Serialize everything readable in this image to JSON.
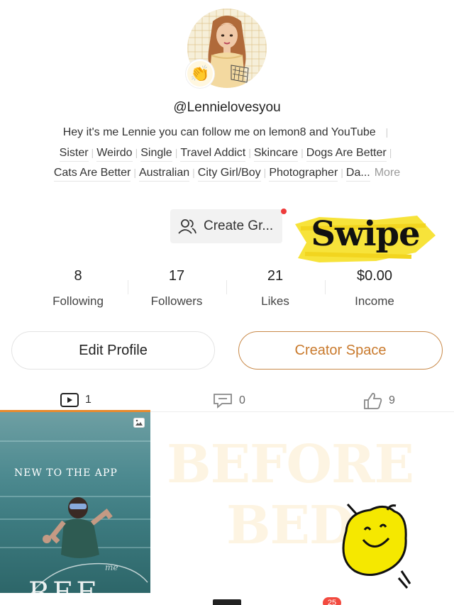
{
  "profile": {
    "username": "@Lennielovesyou",
    "avatar_icon": "cartoon-girl-avatar",
    "avatar_badge_icon": "clapping-hands-emoji",
    "bio": "Hey it's me Lennie you can follow me on lemon8 and YouTube",
    "tags_row1": [
      "Sister",
      "Weirdo",
      "Single",
      "Travel Addict",
      "Skincare",
      "Dogs Are Better"
    ],
    "tags_row2": [
      "Cats Are Better",
      "Australian",
      "City Girl/Boy",
      "Photographer",
      "Da..."
    ],
    "more_label": "More"
  },
  "create_group": {
    "label": "Create Gr...",
    "icon": "group-icon",
    "has_notification_dot": true
  },
  "sticker": {
    "text": "Swipe",
    "color": "#f7e33a"
  },
  "stats": [
    {
      "value": "8",
      "label": "Following"
    },
    {
      "value": "17",
      "label": "Followers"
    },
    {
      "value": "21",
      "label": "Likes"
    },
    {
      "value": "$0.00",
      "label": "Income"
    }
  ],
  "buttons": {
    "edit_profile": "Edit Profile",
    "creator_space": "Creator Space"
  },
  "tabs": [
    {
      "icon": "video-icon",
      "count": "1",
      "active": true
    },
    {
      "icon": "comment-icon",
      "count": "0",
      "active": false
    },
    {
      "icon": "thumbs-up-icon",
      "count": "9",
      "active": false
    }
  ],
  "post": {
    "caption": "NEW TO THE APP",
    "watermark": "me",
    "big_text": "REF",
    "image_icon": "photo-icon"
  },
  "overlay_text": "BEFORE BED",
  "lemon_sticker_icon": "lemon-character-icon",
  "nav": {
    "badge": "25"
  },
  "colors": {
    "accent": "#e98a2c",
    "creator_text": "#c97a2d",
    "badge_red": "#f24a3f",
    "sticker_yellow": "#f7e33a"
  }
}
